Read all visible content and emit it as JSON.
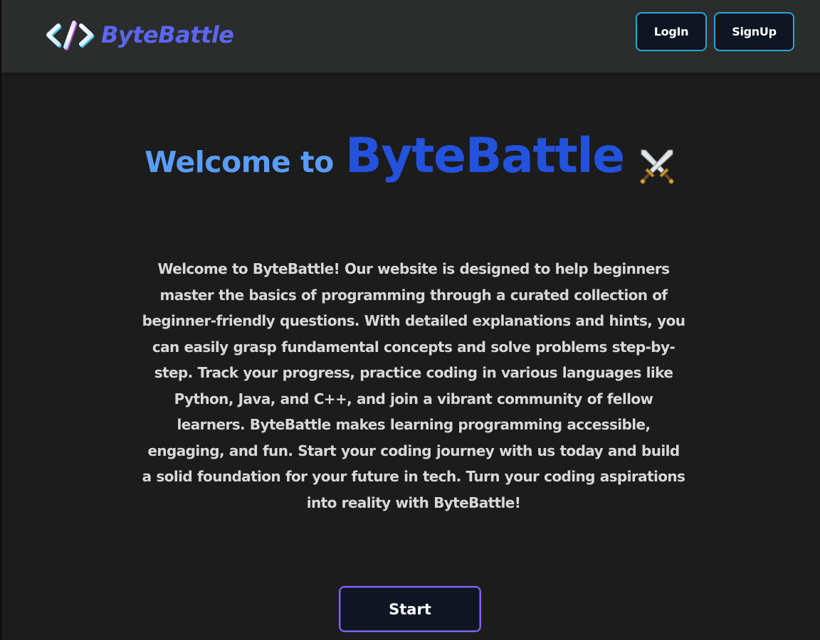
{
  "header": {
    "brand_name": "ByteBattle",
    "brand_icon": "code-brackets-icon",
    "login_label": "LogIn",
    "signup_label": "SignUp"
  },
  "hero": {
    "welcome_prefix": "Welcome to",
    "welcome_brand": "ByteBattle",
    "title_icon": "crossed-swords-icon",
    "description": "Welcome to ByteBattle! Our website is designed to help beginners master the basics of programming through a curated collection of beginner-friendly questions. With detailed explanations and hints, you can easily grasp fundamental concepts and solve problems step-by-step. Track your progress, practice coding in various languages like Python, Java, and C++, and join a vibrant community of fellow learners. ByteBattle makes learning programming accessible, engaging, and fun. Start your coding journey with us today and build a solid foundation for your future in tech. Turn your coding aspirations into reality with ByteBattle!",
    "start_label": "Start"
  },
  "colors": {
    "page_background": "#1c1c1c",
    "navbar_background": "#2b2c2c",
    "brand_accent": "#5b67f0",
    "welcome_prefix": "#5a9df7",
    "welcome_brand": "#2352dd",
    "nav_button_border": "#26a6d8",
    "start_button_border": "#8a5cf2",
    "button_fill": "#0f1523"
  }
}
